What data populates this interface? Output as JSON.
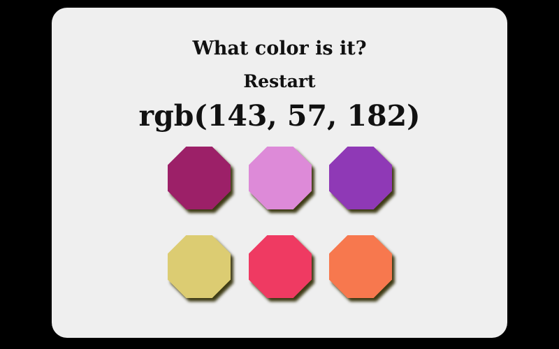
{
  "game": {
    "title": "What color is it?",
    "restart_label": "Restart",
    "target_color": "rgb(143, 57, 182)"
  },
  "swatches": [
    {
      "color": "#9c2068"
    },
    {
      "color": "#dd8ad8"
    },
    {
      "color": "#8f39b6"
    },
    {
      "color": "#dccc72"
    },
    {
      "color": "#ef3a62"
    },
    {
      "color": "#f7784e"
    }
  ]
}
